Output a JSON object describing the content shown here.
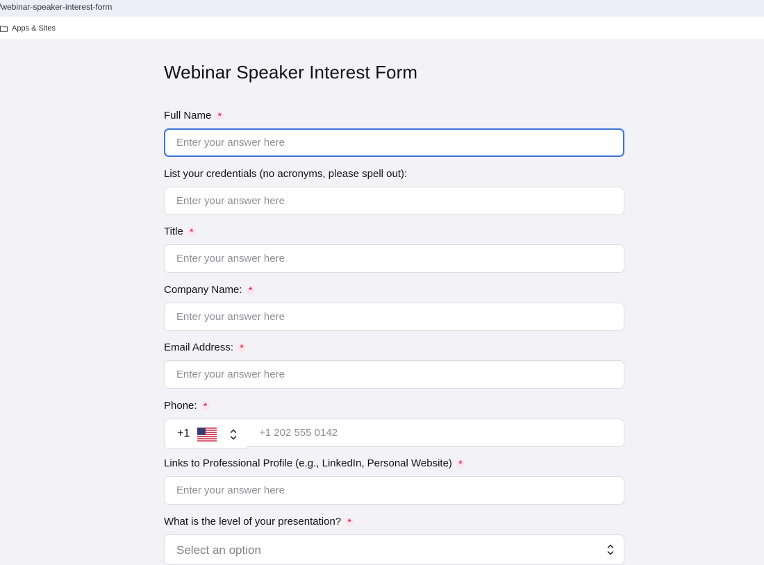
{
  "browser": {
    "url": "/webinar-speaker-interest-form",
    "bookmarks": [
      {
        "label": "Apps & Sites",
        "icon": "folder-icon"
      }
    ]
  },
  "form": {
    "title": "Webinar Speaker Interest Form",
    "fields": [
      {
        "label": "Full Name",
        "required": true,
        "placeholder": "Enter your answer here",
        "value": "",
        "focused": true
      },
      {
        "label": "List your credentials (no acronyms, please spell out):",
        "required": false,
        "placeholder": "Enter your answer here",
        "value": ""
      },
      {
        "label": "Title",
        "required": true,
        "placeholder": "Enter your answer here",
        "value": ""
      },
      {
        "label": "Company Name:",
        "required": true,
        "placeholder": "Enter your answer here",
        "value": ""
      },
      {
        "label": "Email Address:",
        "required": true,
        "placeholder": "Enter your answer here",
        "value": ""
      }
    ],
    "phone": {
      "label": "Phone:",
      "required": true,
      "country_code": "+1",
      "flag_icon": "us-flag-icon",
      "placeholder": "+1 202 555 0142",
      "value": ""
    },
    "profile_links": {
      "label": "Links to Professional Profile (e.g., LinkedIn, Personal Website)",
      "required": true,
      "placeholder": "Enter your answer here",
      "value": ""
    },
    "presentation_level": {
      "label": "What is the level of your presentation?",
      "required": true,
      "selected": "Select an option"
    },
    "required_marker": "*",
    "colors": {
      "focus_border": "#3b74d9",
      "required": "#e0245e",
      "background": "#f3f2f7"
    }
  }
}
